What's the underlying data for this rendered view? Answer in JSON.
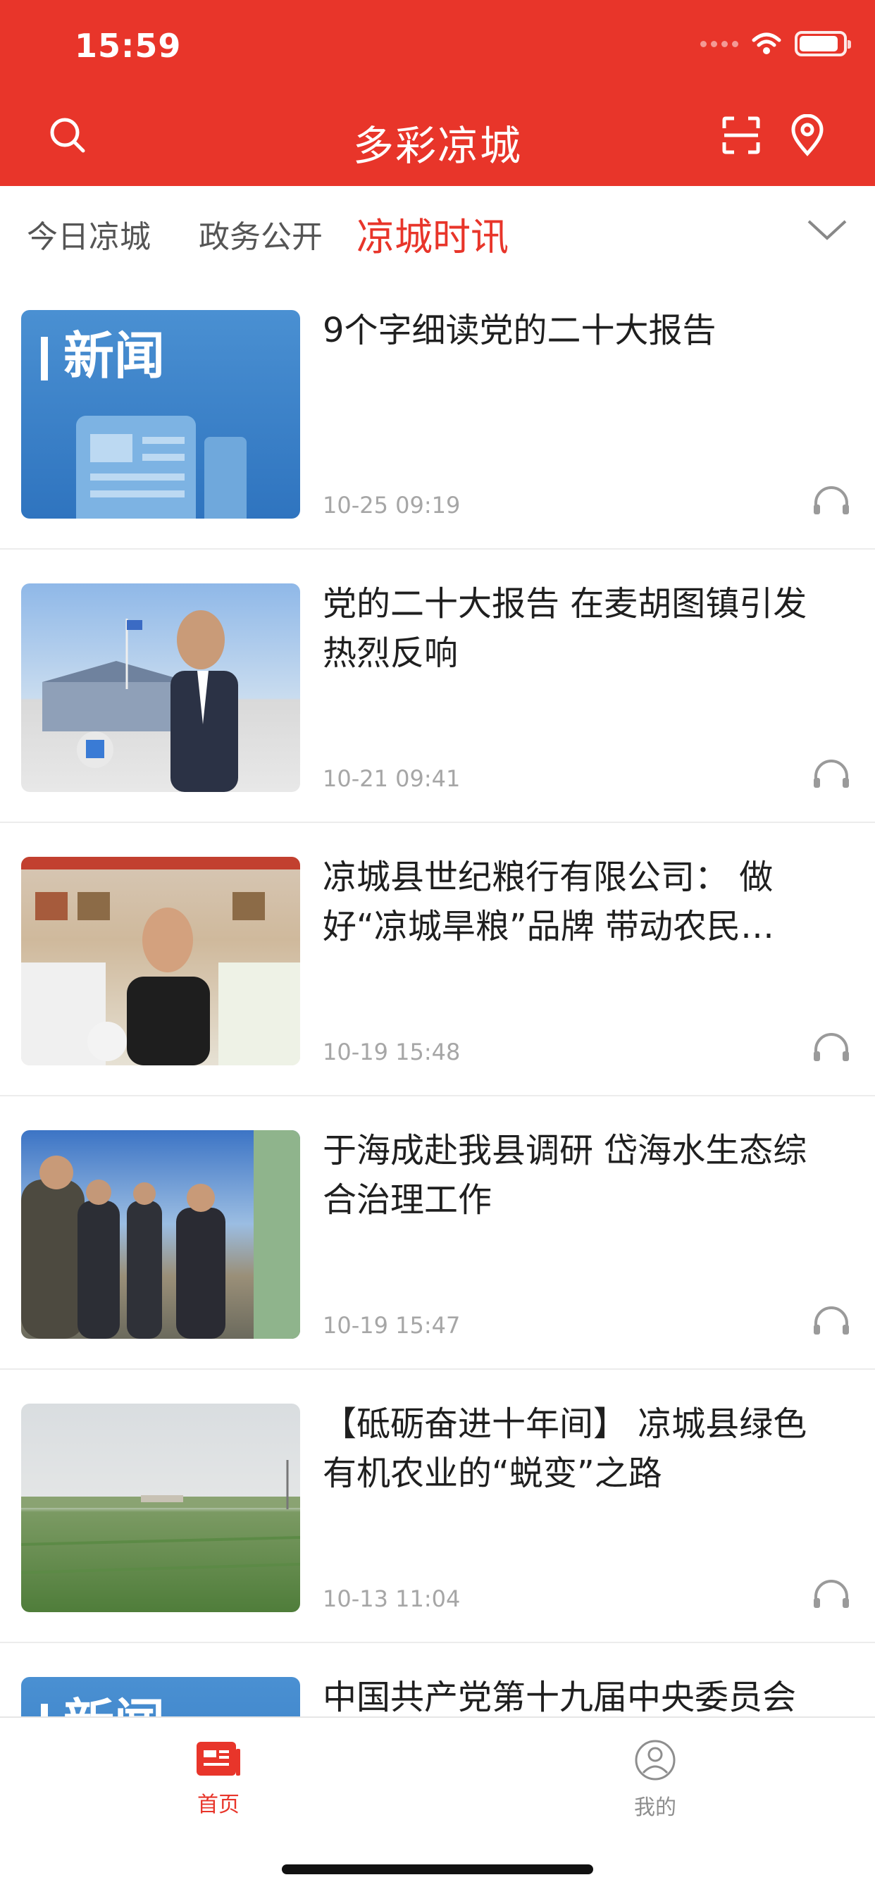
{
  "status_bar": {
    "time": "15:59"
  },
  "header": {
    "title": "多彩凉城",
    "search_icon": "search-icon",
    "scan_icon": "scan-icon",
    "location_icon": "location-pin-icon",
    "bg_color": "#e8352a"
  },
  "tabs": [
    {
      "label": "今日凉城",
      "active": false
    },
    {
      "label": "政务公开",
      "active": false
    },
    {
      "label": "凉城时讯",
      "active": true
    }
  ],
  "news": [
    {
      "title": "9个字细读党的二十大报告",
      "time": "10-25 09:19",
      "thumb_text": "新闻"
    },
    {
      "title": "党的二十大报告 在麦胡图镇引发热烈反响",
      "time": "10-21 09:41"
    },
    {
      "title": "凉城县世纪粮行有限公司： 做好“凉城旱粮”品牌 带动农民…",
      "time": "10-19 15:48"
    },
    {
      "title": "于海成赴我县调研 岱海水生态综合治理工作",
      "time": "10-19 15:47"
    },
    {
      "title": "【砥砺奋进十年间】 凉城县绿色有机农业的“蜕变”之路",
      "time": "10-13 11:04"
    },
    {
      "title": "中国共产党第十九届中央委员会",
      "time": "",
      "thumb_text": "新闻"
    }
  ],
  "tabbar": {
    "home": "首页",
    "mine": "我的",
    "active_color": "#e8352a"
  }
}
